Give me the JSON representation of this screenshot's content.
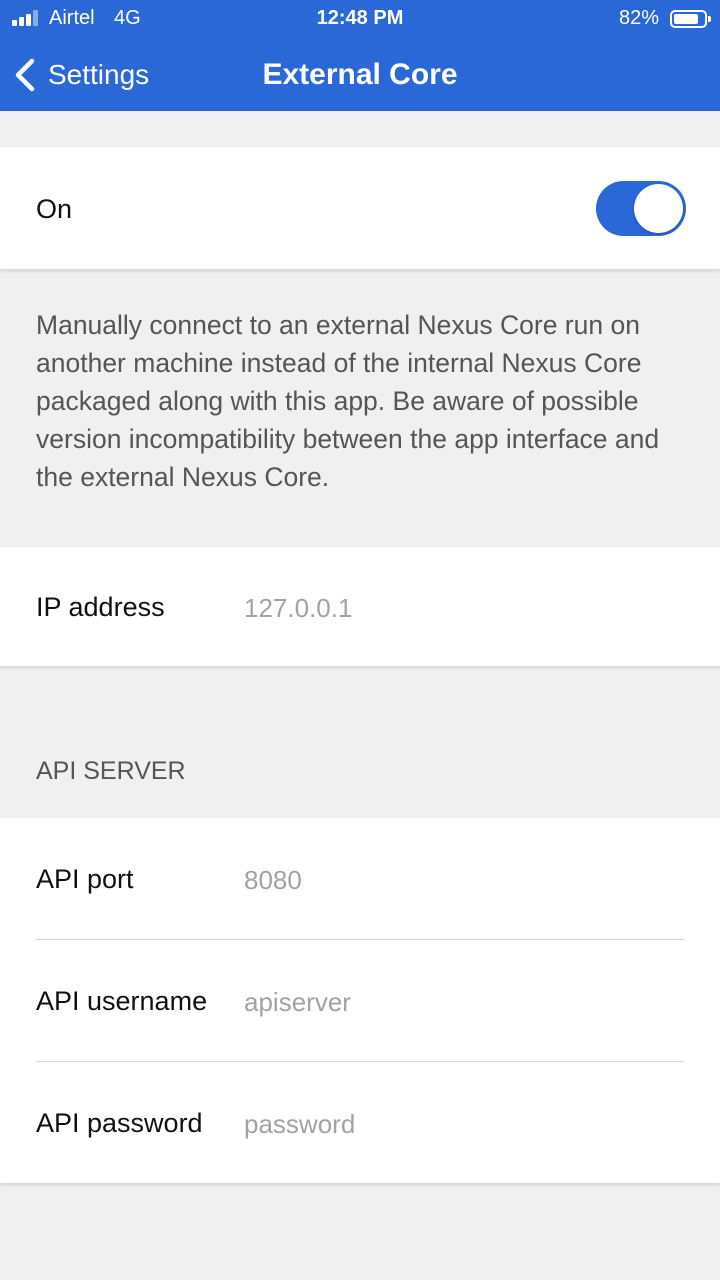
{
  "status_bar": {
    "carrier": "Airtel",
    "network": "4G",
    "time": "12:48 PM",
    "battery": "82%",
    "battery_level": 0.82
  },
  "nav": {
    "back_label": "Settings",
    "title": "External Core"
  },
  "toggle_row": {
    "label": "On",
    "enabled": true
  },
  "description": "Manually connect to an external Nexus Core run on another machine instead of the internal Nexus Core packaged along with this app. Be aware of possible version incompatibility between the app interface and the external Nexus Core.",
  "ip_row": {
    "label": "IP address",
    "placeholder": "127.0.0.1"
  },
  "api_section": {
    "header": "API SERVER",
    "port": {
      "label": "API port",
      "placeholder": "8080"
    },
    "username": {
      "label": "API username",
      "placeholder": "apiserver"
    },
    "password": {
      "label": "API password",
      "placeholder": "password"
    }
  },
  "colors": {
    "accent": "#2a68d8",
    "background": "#f0f0f0",
    "placeholder_text": "#a3a3a3"
  }
}
